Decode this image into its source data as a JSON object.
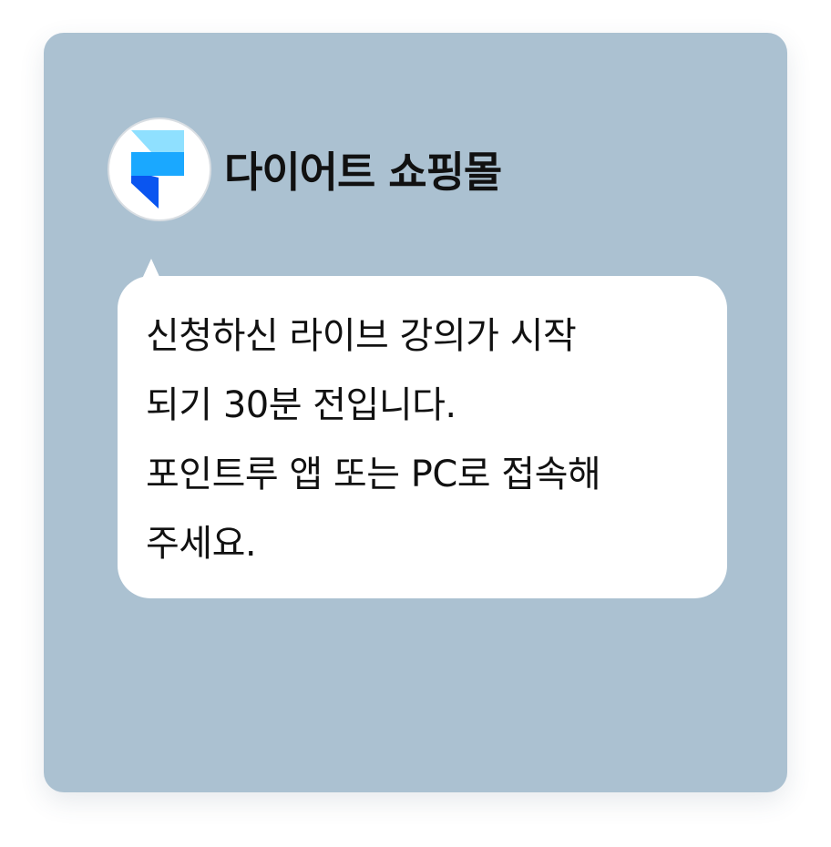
{
  "sender": {
    "name": "다이어트 쇼핑몰",
    "avatar_icon": "framer-logo-icon",
    "avatar_colors": [
      "#8fe0ff",
      "#1aa8ff",
      "#0a55f0"
    ]
  },
  "message": {
    "lines": [
      "신청하신 라이브 강의가 시작",
      "되기 30분 전입니다.",
      "포인트루 앱 또는 PC로 접속해",
      "주세요."
    ]
  },
  "colors": {
    "card_background": "#abc1d1",
    "bubble_background": "#ffffff",
    "text": "#111111"
  }
}
